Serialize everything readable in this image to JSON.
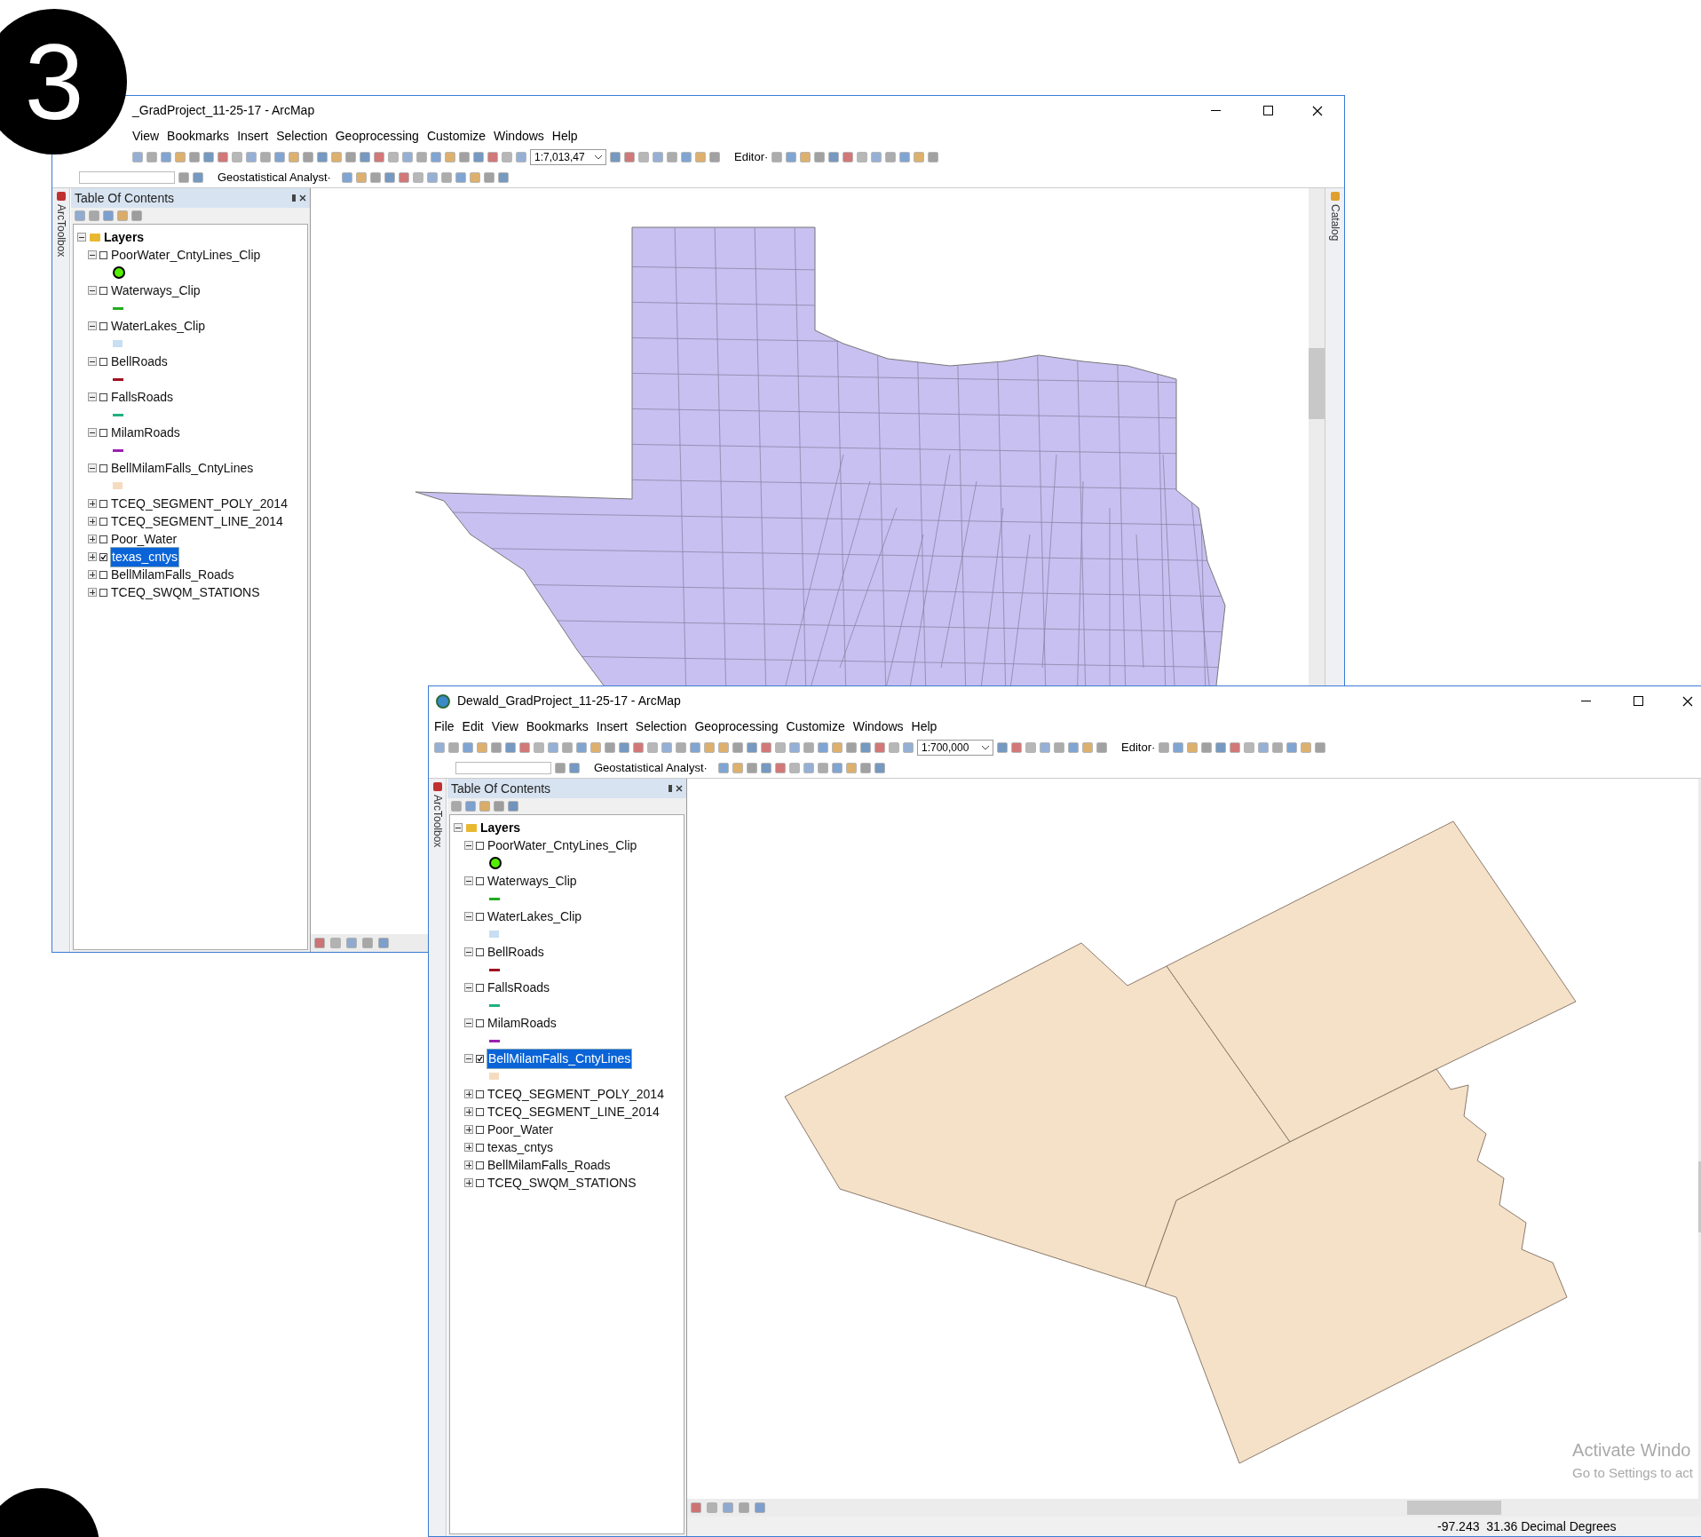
{
  "badge": {
    "label": "3"
  },
  "windows": [
    {
      "title": "_GradProject_11-25-17 - ArcMap",
      "show_app_icon": false,
      "menu": [
        "View",
        "Bookmarks",
        "Insert",
        "Selection",
        "Geoprocessing",
        "Customize",
        "Windows",
        "Help"
      ],
      "scale": "1:7,013,47",
      "editor": "Editor·",
      "geostat": "Geostatistical Analyst·",
      "toolbox_tab": "ArcToolbox",
      "catalog_tab": "Catalog",
      "toc": {
        "title": "Table Of Contents",
        "root": "Layers",
        "layers": [
          {
            "name": "PoorWater_CntyLines_Clip",
            "expanded": true,
            "checked": false,
            "selected": false,
            "symbol": {
              "kind": "point",
              "color": "#55ee00"
            }
          },
          {
            "name": "Waterways_Clip",
            "expanded": true,
            "checked": false,
            "selected": false,
            "symbol": {
              "kind": "line",
              "color": "#22aa22"
            }
          },
          {
            "name": "WaterLakes_Clip",
            "expanded": true,
            "checked": false,
            "selected": false,
            "symbol": {
              "kind": "fill",
              "color": "#c8def2"
            }
          },
          {
            "name": "BellRoads",
            "expanded": true,
            "checked": false,
            "selected": false,
            "symbol": {
              "kind": "line",
              "color": "#a01020"
            }
          },
          {
            "name": "FallsRoads",
            "expanded": true,
            "checked": false,
            "selected": false,
            "symbol": {
              "kind": "line",
              "color": "#20b080"
            }
          },
          {
            "name": "MilamRoads",
            "expanded": true,
            "checked": false,
            "selected": false,
            "symbol": {
              "kind": "line",
              "color": "#9a20b0"
            }
          },
          {
            "name": "BellMilamFalls_CntyLines",
            "expanded": true,
            "checked": false,
            "selected": false,
            "symbol": {
              "kind": "fill",
              "color": "#f5dcc0"
            }
          },
          {
            "name": "TCEQ_SEGMENT_POLY_2014",
            "expanded": false,
            "checked": false,
            "selected": false
          },
          {
            "name": "TCEQ_SEGMENT_LINE_2014",
            "expanded": false,
            "checked": false,
            "selected": false
          },
          {
            "name": "Poor_Water",
            "expanded": false,
            "checked": false,
            "selected": false
          },
          {
            "name": "texas_cntys",
            "expanded": false,
            "checked": true,
            "selected": true
          },
          {
            "name": "BellMilamFalls_Roads",
            "expanded": false,
            "checked": false,
            "selected": false
          },
          {
            "name": "TCEQ_SWQM_STATIONS",
            "expanded": false,
            "checked": false,
            "selected": false
          }
        ]
      },
      "map": {
        "kind": "texas"
      }
    },
    {
      "title": "Dewald_GradProject_11-25-17 - ArcMap",
      "show_app_icon": true,
      "menu": [
        "File",
        "Edit",
        "View",
        "Bookmarks",
        "Insert",
        "Selection",
        "Geoprocessing",
        "Customize",
        "Windows",
        "Help"
      ],
      "scale": "1:700,000",
      "editor": "Editor·",
      "geostat": "Geostatistical Analyst·",
      "toolbox_tab": "ArcToolbox",
      "toc": {
        "title": "Table Of Contents",
        "root": "Layers",
        "layers": [
          {
            "name": "PoorWater_CntyLines_Clip",
            "expanded": true,
            "checked": false,
            "selected": false,
            "symbol": {
              "kind": "point",
              "color": "#55ee00"
            }
          },
          {
            "name": "Waterways_Clip",
            "expanded": true,
            "checked": false,
            "selected": false,
            "symbol": {
              "kind": "line",
              "color": "#22aa22"
            }
          },
          {
            "name": "WaterLakes_Clip",
            "expanded": true,
            "checked": false,
            "selected": false,
            "symbol": {
              "kind": "fill",
              "color": "#c8def2"
            }
          },
          {
            "name": "BellRoads",
            "expanded": true,
            "checked": false,
            "selected": false,
            "symbol": {
              "kind": "line",
              "color": "#a01020"
            }
          },
          {
            "name": "FallsRoads",
            "expanded": true,
            "checked": false,
            "selected": false,
            "symbol": {
              "kind": "line",
              "color": "#20b080"
            }
          },
          {
            "name": "MilamRoads",
            "expanded": true,
            "checked": false,
            "selected": false,
            "symbol": {
              "kind": "line",
              "color": "#9a20b0"
            }
          },
          {
            "name": "BellMilamFalls_CntyLines",
            "expanded": true,
            "checked": true,
            "selected": true,
            "symbol": {
              "kind": "fill",
              "color": "#f5dcc0"
            }
          },
          {
            "name": "TCEQ_SEGMENT_POLY_2014",
            "expanded": false,
            "checked": false,
            "selected": false
          },
          {
            "name": "TCEQ_SEGMENT_LINE_2014",
            "expanded": false,
            "checked": false,
            "selected": false
          },
          {
            "name": "Poor_Water",
            "expanded": false,
            "checked": false,
            "selected": false
          },
          {
            "name": "texas_cntys",
            "expanded": false,
            "checked": false,
            "selected": false
          },
          {
            "name": "BellMilamFalls_Roads",
            "expanded": false,
            "checked": false,
            "selected": false
          },
          {
            "name": "TCEQ_SWQM_STATIONS",
            "expanded": false,
            "checked": false,
            "selected": false
          }
        ]
      },
      "map": {
        "kind": "counties"
      },
      "activation": [
        "Activate Windo",
        "Go to Settings to act"
      ],
      "status": "-97.243  31.36 Decimal Degrees"
    }
  ]
}
